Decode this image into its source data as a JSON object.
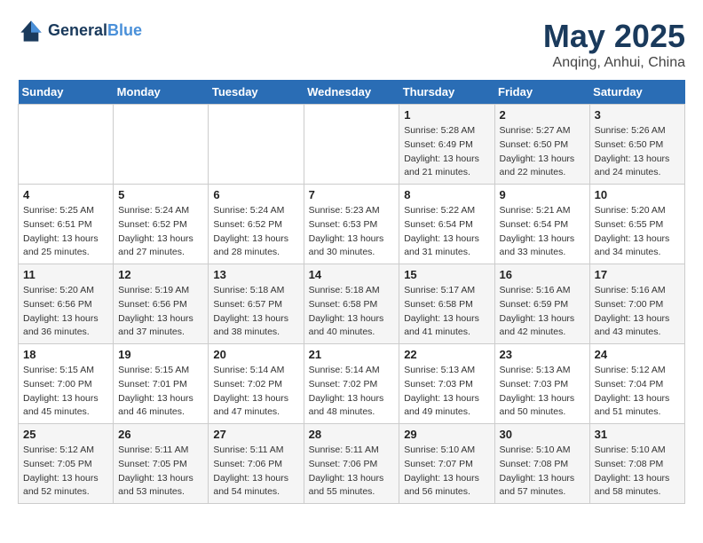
{
  "header": {
    "logo_line1": "General",
    "logo_line2": "Blue",
    "main_title": "May 2025",
    "subtitle": "Anqing, Anhui, China"
  },
  "days_of_week": [
    "Sunday",
    "Monday",
    "Tuesday",
    "Wednesday",
    "Thursday",
    "Friday",
    "Saturday"
  ],
  "weeks": [
    [
      {
        "day": "",
        "info": ""
      },
      {
        "day": "",
        "info": ""
      },
      {
        "day": "",
        "info": ""
      },
      {
        "day": "",
        "info": ""
      },
      {
        "day": "1",
        "info": "Sunrise: 5:28 AM\nSunset: 6:49 PM\nDaylight: 13 hours\nand 21 minutes."
      },
      {
        "day": "2",
        "info": "Sunrise: 5:27 AM\nSunset: 6:50 PM\nDaylight: 13 hours\nand 22 minutes."
      },
      {
        "day": "3",
        "info": "Sunrise: 5:26 AM\nSunset: 6:50 PM\nDaylight: 13 hours\nand 24 minutes."
      }
    ],
    [
      {
        "day": "4",
        "info": "Sunrise: 5:25 AM\nSunset: 6:51 PM\nDaylight: 13 hours\nand 25 minutes."
      },
      {
        "day": "5",
        "info": "Sunrise: 5:24 AM\nSunset: 6:52 PM\nDaylight: 13 hours\nand 27 minutes."
      },
      {
        "day": "6",
        "info": "Sunrise: 5:24 AM\nSunset: 6:52 PM\nDaylight: 13 hours\nand 28 minutes."
      },
      {
        "day": "7",
        "info": "Sunrise: 5:23 AM\nSunset: 6:53 PM\nDaylight: 13 hours\nand 30 minutes."
      },
      {
        "day": "8",
        "info": "Sunrise: 5:22 AM\nSunset: 6:54 PM\nDaylight: 13 hours\nand 31 minutes."
      },
      {
        "day": "9",
        "info": "Sunrise: 5:21 AM\nSunset: 6:54 PM\nDaylight: 13 hours\nand 33 minutes."
      },
      {
        "day": "10",
        "info": "Sunrise: 5:20 AM\nSunset: 6:55 PM\nDaylight: 13 hours\nand 34 minutes."
      }
    ],
    [
      {
        "day": "11",
        "info": "Sunrise: 5:20 AM\nSunset: 6:56 PM\nDaylight: 13 hours\nand 36 minutes."
      },
      {
        "day": "12",
        "info": "Sunrise: 5:19 AM\nSunset: 6:56 PM\nDaylight: 13 hours\nand 37 minutes."
      },
      {
        "day": "13",
        "info": "Sunrise: 5:18 AM\nSunset: 6:57 PM\nDaylight: 13 hours\nand 38 minutes."
      },
      {
        "day": "14",
        "info": "Sunrise: 5:18 AM\nSunset: 6:58 PM\nDaylight: 13 hours\nand 40 minutes."
      },
      {
        "day": "15",
        "info": "Sunrise: 5:17 AM\nSunset: 6:58 PM\nDaylight: 13 hours\nand 41 minutes."
      },
      {
        "day": "16",
        "info": "Sunrise: 5:16 AM\nSunset: 6:59 PM\nDaylight: 13 hours\nand 42 minutes."
      },
      {
        "day": "17",
        "info": "Sunrise: 5:16 AM\nSunset: 7:00 PM\nDaylight: 13 hours\nand 43 minutes."
      }
    ],
    [
      {
        "day": "18",
        "info": "Sunrise: 5:15 AM\nSunset: 7:00 PM\nDaylight: 13 hours\nand 45 minutes."
      },
      {
        "day": "19",
        "info": "Sunrise: 5:15 AM\nSunset: 7:01 PM\nDaylight: 13 hours\nand 46 minutes."
      },
      {
        "day": "20",
        "info": "Sunrise: 5:14 AM\nSunset: 7:02 PM\nDaylight: 13 hours\nand 47 minutes."
      },
      {
        "day": "21",
        "info": "Sunrise: 5:14 AM\nSunset: 7:02 PM\nDaylight: 13 hours\nand 48 minutes."
      },
      {
        "day": "22",
        "info": "Sunrise: 5:13 AM\nSunset: 7:03 PM\nDaylight: 13 hours\nand 49 minutes."
      },
      {
        "day": "23",
        "info": "Sunrise: 5:13 AM\nSunset: 7:03 PM\nDaylight: 13 hours\nand 50 minutes."
      },
      {
        "day": "24",
        "info": "Sunrise: 5:12 AM\nSunset: 7:04 PM\nDaylight: 13 hours\nand 51 minutes."
      }
    ],
    [
      {
        "day": "25",
        "info": "Sunrise: 5:12 AM\nSunset: 7:05 PM\nDaylight: 13 hours\nand 52 minutes."
      },
      {
        "day": "26",
        "info": "Sunrise: 5:11 AM\nSunset: 7:05 PM\nDaylight: 13 hours\nand 53 minutes."
      },
      {
        "day": "27",
        "info": "Sunrise: 5:11 AM\nSunset: 7:06 PM\nDaylight: 13 hours\nand 54 minutes."
      },
      {
        "day": "28",
        "info": "Sunrise: 5:11 AM\nSunset: 7:06 PM\nDaylight: 13 hours\nand 55 minutes."
      },
      {
        "day": "29",
        "info": "Sunrise: 5:10 AM\nSunset: 7:07 PM\nDaylight: 13 hours\nand 56 minutes."
      },
      {
        "day": "30",
        "info": "Sunrise: 5:10 AM\nSunset: 7:08 PM\nDaylight: 13 hours\nand 57 minutes."
      },
      {
        "day": "31",
        "info": "Sunrise: 5:10 AM\nSunset: 7:08 PM\nDaylight: 13 hours\nand 58 minutes."
      }
    ]
  ]
}
